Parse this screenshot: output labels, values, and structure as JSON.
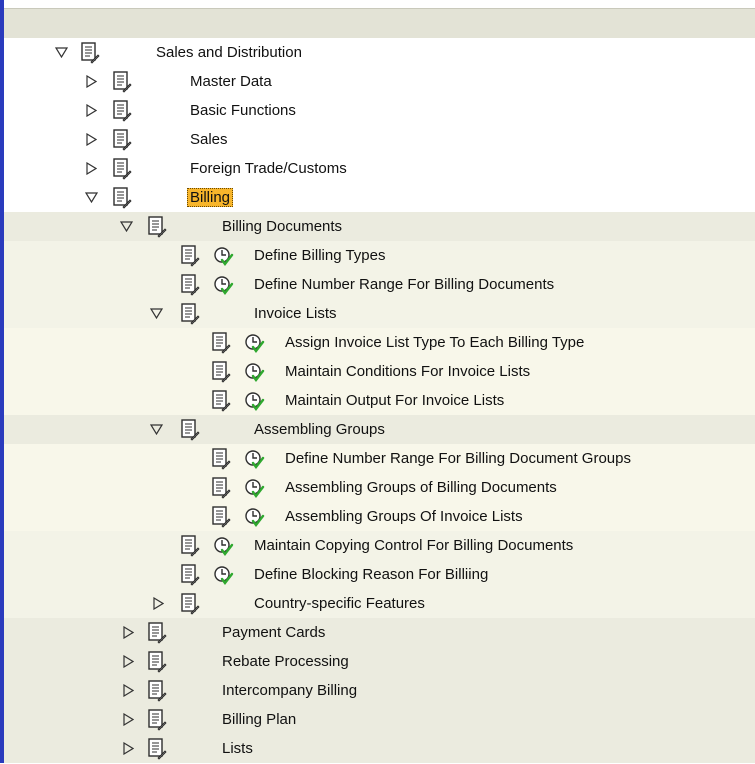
{
  "tree": {
    "items": [
      {
        "label": "Sales and Distribution",
        "toggle": "expanded",
        "activity": false,
        "selected": false
      },
      {
        "label": "Master Data",
        "toggle": "collapsed",
        "activity": false,
        "selected": false
      },
      {
        "label": "Basic Functions",
        "toggle": "collapsed",
        "activity": false,
        "selected": false
      },
      {
        "label": "Sales",
        "toggle": "collapsed",
        "activity": false,
        "selected": false
      },
      {
        "label": "Foreign Trade/Customs",
        "toggle": "collapsed",
        "activity": false,
        "selected": false
      },
      {
        "label": "Billing",
        "toggle": "expanded",
        "activity": false,
        "selected": true
      },
      {
        "label": "Billing Documents",
        "toggle": "expanded",
        "activity": false,
        "selected": false
      },
      {
        "label": "Define Billing Types",
        "toggle": "none",
        "activity": true,
        "selected": false
      },
      {
        "label": "Define Number Range For Billing Documents",
        "toggle": "none",
        "activity": true,
        "selected": false
      },
      {
        "label": "Invoice Lists",
        "toggle": "expanded",
        "activity": false,
        "selected": false
      },
      {
        "label": "Assign Invoice List Type To Each Billing Type",
        "toggle": "none",
        "activity": true,
        "selected": false
      },
      {
        "label": "Maintain Conditions For Invoice Lists",
        "toggle": "none",
        "activity": true,
        "selected": false
      },
      {
        "label": "Maintain Output For Invoice Lists",
        "toggle": "none",
        "activity": true,
        "selected": false
      },
      {
        "label": "Assembling Groups",
        "toggle": "expanded",
        "activity": false,
        "selected": false
      },
      {
        "label": "Define Number Range For Billing Document Groups",
        "toggle": "none",
        "activity": true,
        "selected": false
      },
      {
        "label": "Assembling Groups of Billing Documents",
        "toggle": "none",
        "activity": true,
        "selected": false
      },
      {
        "label": "Assembling Groups Of Invoice Lists",
        "toggle": "none",
        "activity": true,
        "selected": false
      },
      {
        "label": "Maintain Copying Control For Billing Documents",
        "toggle": "none",
        "activity": true,
        "selected": false
      },
      {
        "label": "Define Blocking Reason For Billiing",
        "toggle": "none",
        "activity": true,
        "selected": false
      },
      {
        "label": "Country-specific Features",
        "toggle": "collapsed",
        "activity": false,
        "selected": false
      },
      {
        "label": "Payment Cards",
        "toggle": "collapsed",
        "activity": false,
        "selected": false
      },
      {
        "label": "Rebate Processing",
        "toggle": "collapsed",
        "activity": false,
        "selected": false
      },
      {
        "label": "Intercompany Billing",
        "toggle": "collapsed",
        "activity": false,
        "selected": false
      },
      {
        "label": "Billing Plan",
        "toggle": "collapsed",
        "activity": false,
        "selected": false
      },
      {
        "label": "Lists",
        "toggle": "collapsed",
        "activity": false,
        "selected": false
      }
    ]
  },
  "icons": {
    "expanded": "expanded-triangle-icon",
    "collapsed": "collapsed-triangle-icon",
    "document": "documentation-icon",
    "activity": "execute-activity-icon"
  },
  "colors": {
    "frame_border": "#2a3bbd",
    "selection": "#f7b52b",
    "activity_check": "#2fa82f"
  }
}
